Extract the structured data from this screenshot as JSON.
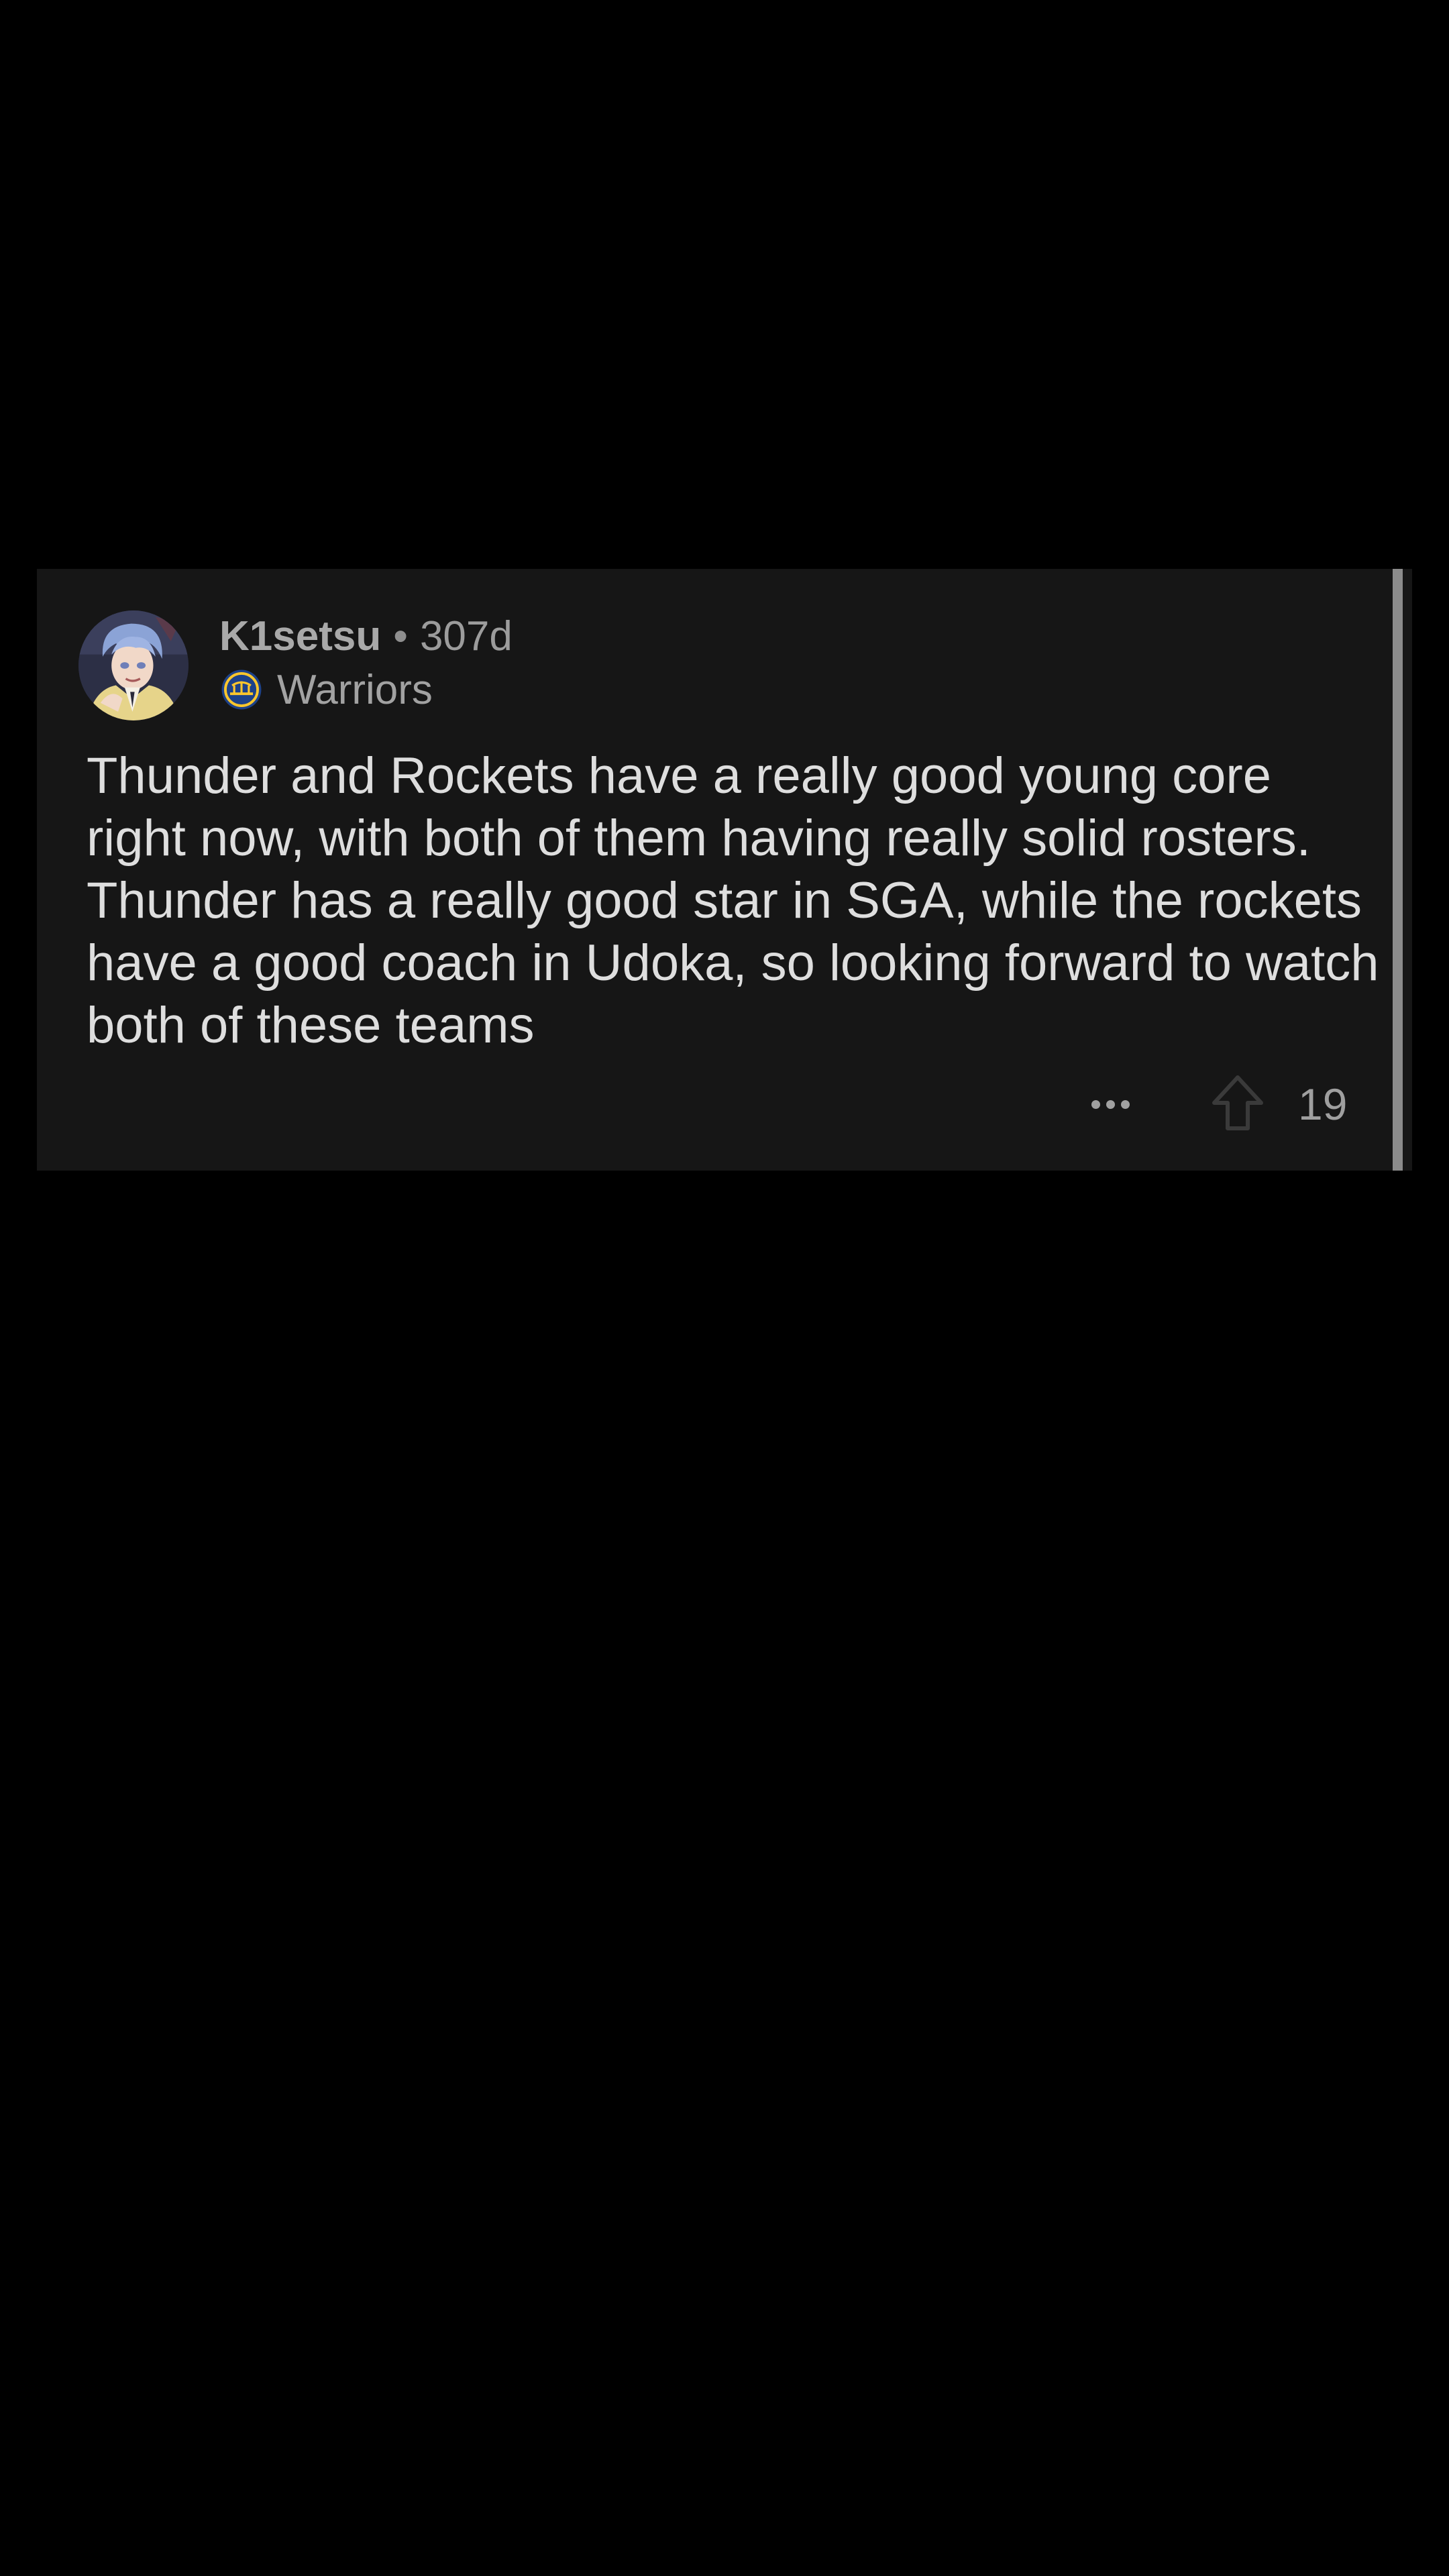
{
  "comment": {
    "username": "K1setsu",
    "separator": "•",
    "age": "307d",
    "flair": {
      "icon": "warriors-logo-icon",
      "label": "Warriors"
    },
    "body": "Thunder and Rockets have a really good young core right now, with both of them having really solid rosters. Thunder has a really good star in SGA, while the rockets have a good coach in Udoka, so looking forward to watch both of these teams",
    "actions": {
      "more_icon": "more-options-icon",
      "upvote_icon": "upvote-arrow-icon",
      "vote_count": "19"
    }
  },
  "colors": {
    "background": "#000000",
    "card": "#161616",
    "thread_line": "#8b8b8b",
    "body_text": "#dedede",
    "meta_text": "#a9a9a9"
  }
}
